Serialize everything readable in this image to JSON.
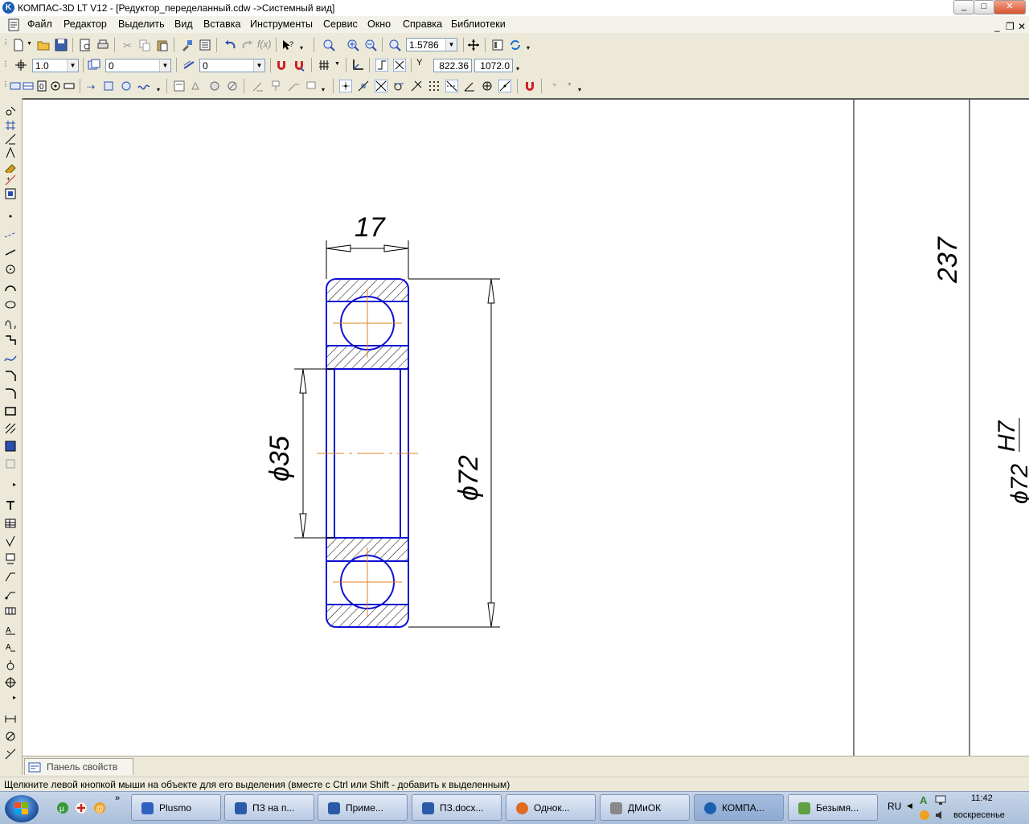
{
  "window": {
    "app_icon_letter": "K",
    "title": "КОМПАС-3D LT V12 - [Редуктор_переделанный.cdw ->Системный вид]",
    "min_label": "_",
    "max_label": "□",
    "close_label": "✕"
  },
  "menu": {
    "items": [
      "Файл",
      "Редактор",
      "Выделить",
      "Вид",
      "Вставка",
      "Инструменты",
      "Сервис",
      "Окно",
      "Справка",
      "Библиотеки"
    ],
    "mdi_minimize": "_",
    "mdi_restore": "❐",
    "mdi_close": "✕"
  },
  "toolbar": {
    "zoom_value": "1.5786",
    "line_scale": "1.0",
    "layer_value": "0",
    "style_value": "0",
    "coord_x": "822.36",
    "coord_y": "1072.0",
    "coord_label": "Y",
    "fx_label": "f(x)"
  },
  "drawing": {
    "dim_width": "17",
    "dim_inner": "ϕ35",
    "dim_outer": "ϕ72",
    "dim_right": "237",
    "dim_fit": "ϕ72",
    "fit_tolerance": "H7",
    "line_color": "#1010d0",
    "axis_color": "#e08020"
  },
  "properties_panel": {
    "tab_label": "Панель свойств"
  },
  "status": {
    "hint": "Щелкните левой кнопкой мыши на объекте для его выделения (вместе с Ctrl или Shift - добавить к выделенным)"
  },
  "taskbar": {
    "quicklaunch_more": "»",
    "tasks": [
      "Plusmo",
      "ПЗ на п...",
      "Приме...",
      "ПЗ.docx...",
      "Однок...",
      "ДМиОК",
      "КОМПА...",
      "Безымя..."
    ],
    "lang": "RU",
    "time": "11:42",
    "day": "воскресенье"
  }
}
